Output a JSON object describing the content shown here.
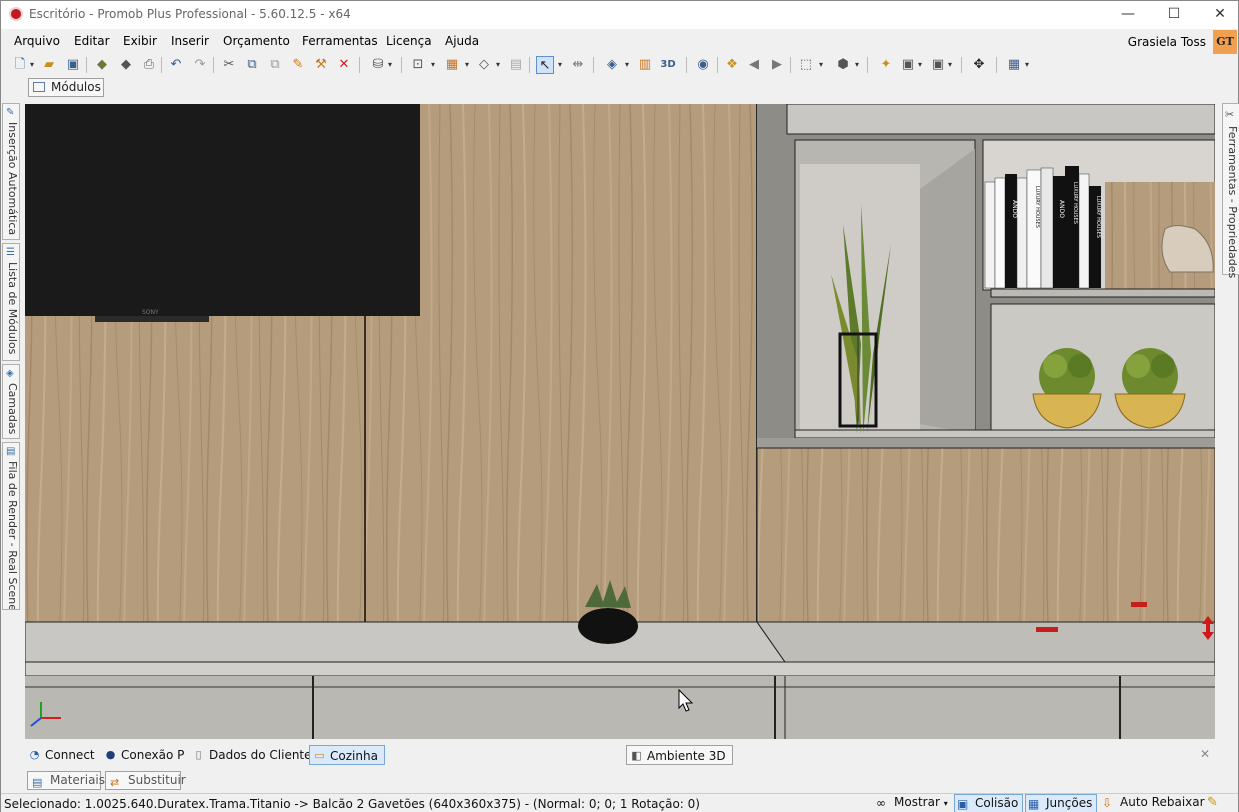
{
  "window": {
    "title": "Escritório - Promob Plus Professional - 5.60.12.5 - x64",
    "minimize": "—",
    "maximize": "☐",
    "close": "✕"
  },
  "menu": [
    "Arquivo",
    "Editar",
    "Exibir",
    "Inserir",
    "Orçamento",
    "Ferramentas",
    "Licença",
    "Ajuda"
  ],
  "user": {
    "name": "Grasiela Toss",
    "initials": "GT"
  },
  "top_tab": "Módulos",
  "left_tabs": [
    "Inserção Automática",
    "Lista de Módulos",
    "Camadas",
    "Fila de Render - Real Scene"
  ],
  "right_tab": "Ferramentas - Propriedades",
  "doc_tabs": [
    "Connect",
    "Conexão P",
    "Dados do Cliente",
    "Cozinha"
  ],
  "view_tab": "Ambiente 3D",
  "bottom_tabs": [
    "Materiais",
    "Substituir"
  ],
  "status": {
    "selected": "Selecionado: 1.0025.640.Duratex.Trama.Titanio -> Balcão 2 Gavetões (640x360x375) - (Normal: 0; 0; 1 Rotação: 0)",
    "mostrar": "Mostrar",
    "colisao": "Colisão",
    "juncoes": "Junções",
    "auto_rebaixar": "Auto Rebaixar"
  },
  "scene": {
    "tv_brand": "SONY",
    "book_labels": [
      "ANDO",
      "LUXURY HOUSES",
      "ANDO",
      "LUXURY HOUSES",
      "LUXURY HOUSES"
    ]
  },
  "colors": {
    "wood": "#b59c7c",
    "panel_gray": "#c9c7c3",
    "accent": "#c0181e",
    "selection": "#dbeafb"
  }
}
